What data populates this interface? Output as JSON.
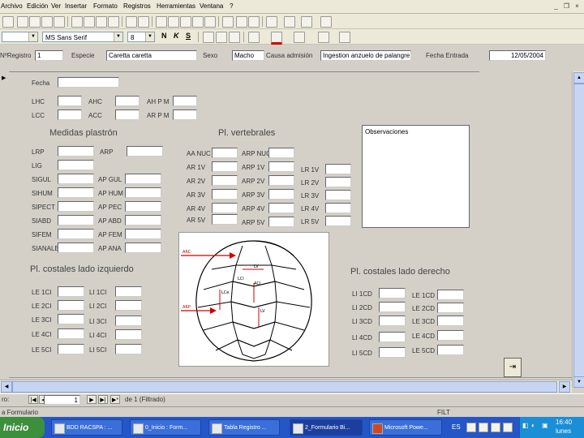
{
  "menu": [
    "Archivo",
    "Edición",
    "Ver",
    "Insertar",
    "Formato",
    "Registros",
    "Herramientas",
    "Ventana",
    "?"
  ],
  "format_bar": {
    "font": "MS Sans Serif",
    "size": "8",
    "bold": "N",
    "italic": "K",
    "underline": "S"
  },
  "header": {
    "registro_label": "NºRegistro",
    "registro_value": "1",
    "especie_label": "Especie",
    "especie_value": "Caretta caretta",
    "sexo_label": "Sexo",
    "sexo_value": "Macho",
    "causa_label": "Causa admisión",
    "causa_value": "Ingestion anzuelo de palangre",
    "fecha_entrada_label": "Fecha Entrada",
    "fecha_entrada_value": "12/05/2004"
  },
  "form": {
    "fecha_label": "Fecha",
    "lhc": "LHC",
    "ahc": "AHC",
    "ah_pm": "AH P M",
    "lcc": "LCC",
    "acc": "ACC",
    "ar_pm": "AR P M",
    "observaciones": "Observaciones"
  },
  "plastron": {
    "title": "Medidas plastrón",
    "left": [
      "LRP",
      "LIG",
      "SIGUL",
      "SIHUM",
      "SIPECT",
      "SIABD",
      "SIFEM",
      "SIANALE"
    ],
    "right": [
      "ARP",
      "AP GUL",
      "AP HUM",
      "AP PEC",
      "AP ABD",
      "AP FEM",
      "AP ANA"
    ]
  },
  "vertebrales": {
    "title": "Pl. vertebrales",
    "col1": [
      "AA NUC",
      "AR 1V",
      "AR 2V",
      "AR 3V",
      "AR 4V",
      "AR 5V"
    ],
    "col2": [
      "ARP NUC",
      "ARP 1V",
      "ARP 2V",
      "ARP 3V",
      "ARP 4V",
      "ARP 5V"
    ],
    "col3": [
      "LR 1V",
      "LR 2V",
      "LR 3V",
      "LR 4V",
      "LR 5V"
    ]
  },
  "costales_izq": {
    "title": "Pl. costales lado izquierdo",
    "col1": [
      "LE 1CI",
      "LE 2CI",
      "LE 3CI",
      "LE 4CI",
      "LE 5CI"
    ],
    "col2": [
      "LI 1CI",
      "LI 2CI",
      "LI 3CI",
      "LI 4CI",
      "LI 5CI"
    ]
  },
  "costales_der": {
    "title": "Pl. costales lado derecho",
    "col1": [
      "LI 1CD",
      "LI 2CD",
      "LI 3CD",
      "LI 4CD",
      "LI 5CD"
    ],
    "col2": [
      "LE 1CD",
      "LE 2CD",
      "LE 3CD",
      "LE 4CD",
      "LE 5CD"
    ]
  },
  "diagram": {
    "top_label": "ARC",
    "mid_label": "ARP",
    "labels": [
      "LV",
      "LCI",
      "ACI",
      "LCe",
      "LV"
    ]
  },
  "navigation": {
    "label": "ro:",
    "current": "1",
    "of_text": "de 1 (Filtrado)"
  },
  "status": {
    "left": "a Formulario",
    "right": "FILT"
  },
  "taskbar": {
    "start": "Inicio",
    "tasks": [
      "BDD RACSPA : ...",
      "0_Inicio : Form...",
      "Tabla Registro ...",
      "2_Formulario Bi...",
      "Microsoft Powe..."
    ],
    "lang": "ES",
    "time": "16:40",
    "day": "lunes"
  },
  "colors": {
    "taskbar": "#2456c8",
    "start": "#3c8f3c",
    "arrow_red": "#cc0000"
  }
}
